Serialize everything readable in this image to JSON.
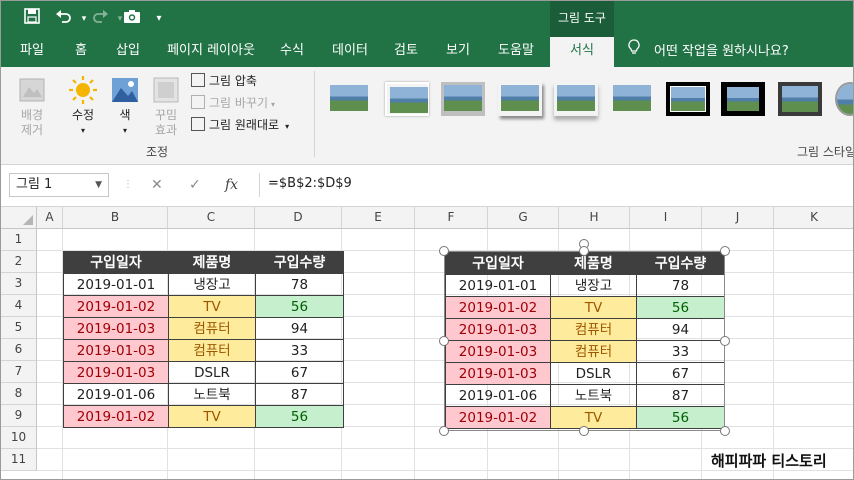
{
  "titlebar": {
    "context_tab_header": "그림 도구",
    "qat": [
      "save-icon",
      "undo-icon",
      "redo-icon",
      "camera-icon",
      "customize-icon"
    ]
  },
  "tabs": [
    "파일",
    "홈",
    "삽입",
    "페이지 레이아웃",
    "수식",
    "데이터",
    "검토",
    "보기",
    "도움말",
    "서식"
  ],
  "active_tab": "서식",
  "tell_me": "어떤 작업을 원하시나요?",
  "ribbon": {
    "remove_bg": "배경\n제거",
    "remove_bg_l1": "배경",
    "remove_bg_l2": "제거",
    "corrections": "수정",
    "color": "색",
    "artistic_l1": "꾸밈",
    "artistic_l2": "효과",
    "compress": "그림 압축",
    "change": "그림 바꾸기",
    "reset": "그림 원래대로",
    "adjust_group": "조정",
    "styles_group": "그림 스타일"
  },
  "formula_bar": {
    "name_box": "그림 1",
    "cancel": "✕",
    "enter": "✓",
    "fx": "fx",
    "formula": "=$B$2:$D$9"
  },
  "columns": [
    "A",
    "B",
    "C",
    "D",
    "E",
    "F",
    "G",
    "H",
    "I",
    "J",
    "K"
  ],
  "rows": [
    "1",
    "2",
    "3",
    "4",
    "5",
    "6",
    "7",
    "8",
    "9",
    "10",
    "11"
  ],
  "table": {
    "headers": [
      "구입일자",
      "제품명",
      "구입수량"
    ],
    "rows": [
      {
        "date": "2019-01-01",
        "product": "냉장고",
        "qty": "78"
      },
      {
        "date": "2019-01-02",
        "product": "TV",
        "qty": "56"
      },
      {
        "date": "2019-01-03",
        "product": "컴퓨터",
        "qty": "94"
      },
      {
        "date": "2019-01-03",
        "product": "컴퓨터",
        "qty": "33"
      },
      {
        "date": "2019-01-03",
        "product": "DSLR",
        "qty": "67"
      },
      {
        "date": "2019-01-06",
        "product": "노트북",
        "qty": "87"
      },
      {
        "date": "2019-01-02",
        "product": "TV",
        "qty": "56"
      }
    ]
  },
  "colors": {
    "excel_green": "#217346",
    "header_dark": "#3f3f3f",
    "pink_fill": "#ffc7ce",
    "yellow_fill": "#ffeb9c",
    "green_fill": "#c6efce"
  },
  "watermark": "해피파파 티스토리"
}
